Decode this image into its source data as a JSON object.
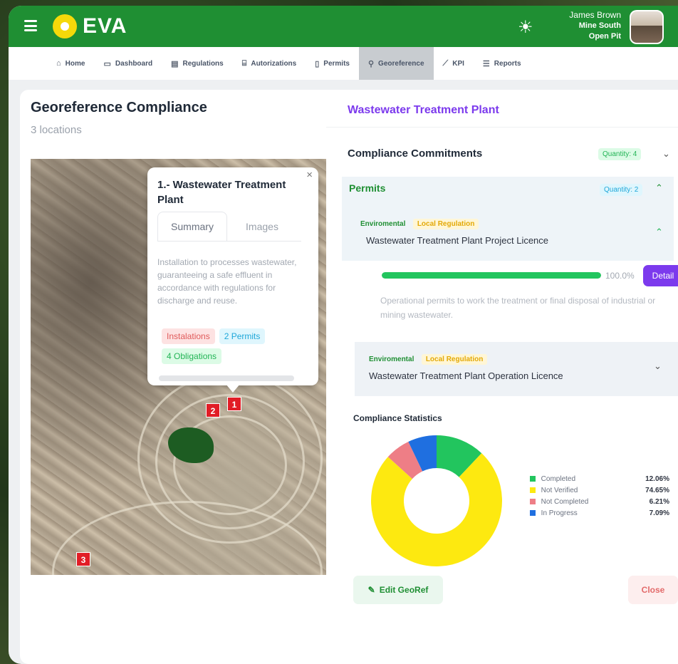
{
  "app": {
    "logo_text": "EVA"
  },
  "user": {
    "name": "James Brown",
    "site": "Mine South",
    "pit": "Open Pit"
  },
  "nav": [
    {
      "label": "Home",
      "icon": "home-icon"
    },
    {
      "label": "Dashboard",
      "icon": "dashboard-icon"
    },
    {
      "label": "Regulations",
      "icon": "regulations-icon"
    },
    {
      "label": "Autorizations",
      "icon": "bank-icon"
    },
    {
      "label": "Permits",
      "icon": "document-icon"
    },
    {
      "label": "Georeference",
      "icon": "location-pin-icon",
      "active": true
    },
    {
      "label": "KPI",
      "icon": "chart-line-icon"
    },
    {
      "label": "Reports",
      "icon": "list-icon"
    }
  ],
  "left": {
    "title": "Georeference Compliance",
    "subtitle": "3 locations"
  },
  "popup": {
    "title": "1.- Wastewater Treatment Plant",
    "tabs": [
      "Summary",
      "Images"
    ],
    "description": "Installation to processes wastewater, guaranteeing a safe effluent in accordance with regulations for discharge and reuse.",
    "badges": [
      "Instalations",
      "2 Permits",
      "4 Obligations"
    ]
  },
  "markers": [
    "1",
    "2",
    "3"
  ],
  "right": {
    "title": "Wastewater Treatment Plant",
    "commitments": {
      "label": "Compliance Commitments",
      "qty": "Quantity: 4"
    },
    "permits": {
      "label": "Permits",
      "qty": "Quantity: 2"
    },
    "permit_items": [
      {
        "tag1": "Enviromental",
        "tag2": "Local Regulation",
        "name": "Wastewater Treatment Plant Project Licence",
        "progress": 100,
        "progress_label": "100.0%",
        "detail": "Detail",
        "description": "Operational permits to work the treatment or final disposal of industrial or mining wastewater."
      },
      {
        "tag1": "Enviromental",
        "tag2": "Local Regulation",
        "name": "Wastewater Treatment Plant Operation Licence"
      }
    ],
    "stats_title": "Compliance Statistics",
    "edit_label": "Edit GeoRef",
    "close_label": "Close"
  },
  "chart_data": {
    "type": "pie",
    "categories": [
      "Completed",
      "Not Verified",
      "Not Completed",
      "In Progress"
    ],
    "values": [
      12.06,
      74.65,
      6.21,
      7.09
    ],
    "value_labels": [
      "12.06%",
      "74.65%",
      "6.21%",
      "7.09%"
    ],
    "colors": [
      "#22c55e",
      "#fde910",
      "#ee7e86",
      "#1f6fe0"
    ]
  }
}
